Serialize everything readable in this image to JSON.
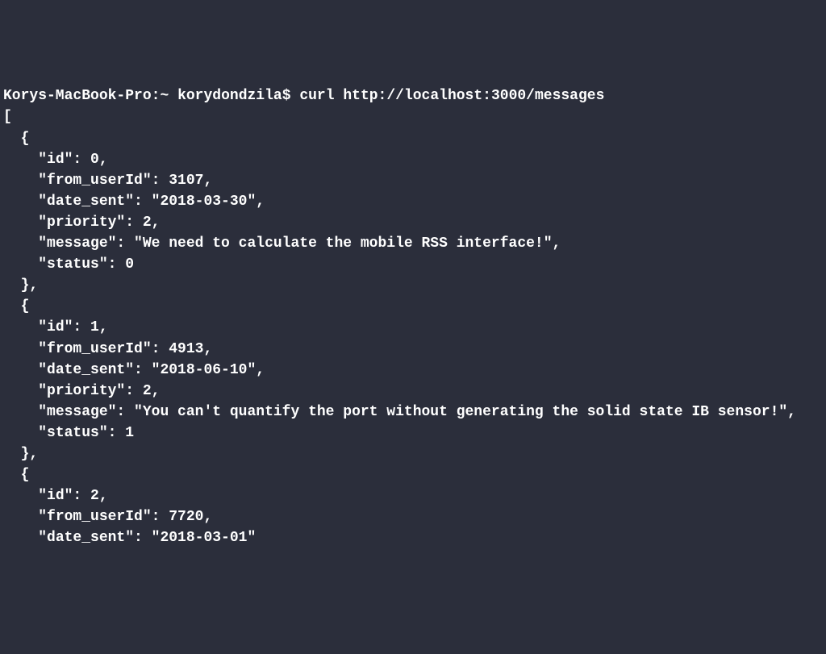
{
  "prompt": {
    "host": "Korys-MacBook-Pro",
    "path": "~",
    "user": "korydondzila",
    "symbol": "$",
    "command": "curl http://localhost:3000/messages"
  },
  "output": {
    "open_bracket": "[",
    "records": [
      {
        "open": "  {",
        "id_line": "    \"id\": 0,",
        "from_line": "    \"from_userId\": 3107,",
        "date_line": "    \"date_sent\": \"2018-03-30\",",
        "priority_line": "    \"priority\": 2,",
        "message_line": "    \"message\": \"We need to calculate the mobile RSS interface!\",",
        "status_line": "    \"status\": 0",
        "close": "  },"
      },
      {
        "open": "  {",
        "id_line": "    \"id\": 1,",
        "from_line": "    \"from_userId\": 4913,",
        "date_line": "    \"date_sent\": \"2018-06-10\",",
        "priority_line": "    \"priority\": 2,",
        "message_line": "    \"message\": \"You can't quantify the port without generating the solid state IB sensor!\",",
        "status_line": "    \"status\": 1",
        "close": "  },"
      },
      {
        "open": "  {",
        "id_line": "    \"id\": 2,",
        "from_line": "    \"from_userId\": 7720,",
        "date_line": "    \"date_sent\": \"2018-03-01\""
      }
    ]
  }
}
